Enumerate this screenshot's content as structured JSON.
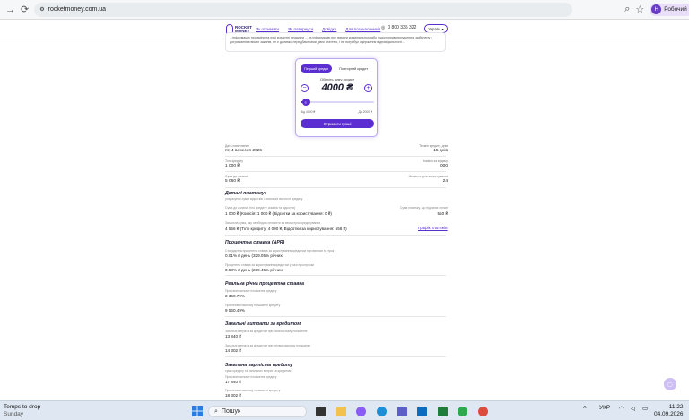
{
  "browser": {
    "url": "rocketmoney.com.ua",
    "profile_initial": "Н",
    "profile_name": "Робочий"
  },
  "site": {
    "logo_line1": "ROCKET",
    "logo_line2": "MONEY",
    "nav": [
      "Як отримати",
      "Як повернути",
      "Довідка",
      "Для позичальників"
    ],
    "phone": "0 800 335 322",
    "language": "Україн",
    "notice_text": "...інформацію про зміни та нові кредитні продукти ... та інформацію про вимоги кримінального або іншого правопорушення, здійснену з дотриманням вимог законів, не є даними, передбаченими діючі статтею, і не потребує одержання відповідальності..."
  },
  "calculator": {
    "tab_first": "Перший кредит",
    "tab_repeat": "Повторний кредит",
    "amount_label": "Оберіть суму позики",
    "amount": "4000 ₴",
    "slider_fraction": 0.07,
    "min_label": "Від 4000 ₴",
    "max_label": "До 2000 ₴",
    "cta": "Отримати гроші"
  },
  "summary": {
    "date_label": "Дата повернення",
    "date_value": "пт, 4 вересня 2026",
    "term_label": "Термін кредиту, днів",
    "term_value": "15 днів",
    "body_label": "Тіло кредиту",
    "body_value": "1 000 ₴",
    "fee_label": "Комісія за видачу",
    "fee_value": "000",
    "total_label": "Сума до сплати",
    "total_value": "5 060 ₴",
    "days_label": "Кількість днів користування",
    "days_value": "24"
  },
  "details": {
    "title": "Деталі платежу:",
    "subtitle": "розрахунок суми, відсотків і загальної вартості кредиту",
    "row1_label": "Сума до сплати (тіло кредиту, комісія та відсотки)",
    "row1_value": "1 000 ₴ (Комісія: 1 000 ₴ (Відсотки за користування: 0 ₴)",
    "row1_right_label": "Сума платежу, що підлягає сплаті",
    "row1_right_value": "550 ₴",
    "row2_label": "Загальна сума, яку необхідно сплатити за весь строк кредитування",
    "row2_value": "4 556 ₴ (Тіло кредиту: 4 000 ₴, Відсотки за користування: 556 ₴)",
    "schedule_link": "Графік платежів"
  },
  "apr": {
    "title": "Процентна ставка (APR)",
    "a_label": "Стандартна процентна ставка за користування кредитом при виплаті в строк",
    "a_value": "0.01% в день (329.05% річних)",
    "b_label": "Процентна ставка за користування кредитом у разі прострочки",
    "b_value": "0.53% в день (239.45% річних)"
  },
  "real_rate": {
    "title": "Реальна річна процентна ставка",
    "a_label": "При своєчасному погашенні кредиту",
    "a_value": "3 350.79%",
    "b_label": "При несвоєчасному погашенні кредиту",
    "b_value": "9 560.49%"
  },
  "total_costs": {
    "title": "Загальні витрати за кредитом",
    "a_label": "Загальні витрати за кредитом при своєчасному погашенні",
    "a_value": "13 840 ₴",
    "b_label": "Загальні витрати за кредитом при несвоєчасному погашенні",
    "b_value": "14 302 ₴"
  },
  "total_cost": {
    "title": "Загальна вартість кредиту",
    "subtitle": "сума кредиту та загальних витрат за кредитом",
    "a_label": "При своєчасному погашенні кредиту",
    "a_value": "17 840 ₴",
    "b_label": "При несвоєчасному погашенні кредиту",
    "b_value": "18 302 ₴"
  },
  "taskbar": {
    "weather_title": "Temps to drop",
    "weather_sub": "Sunday",
    "search_placeholder": "Пошук",
    "lang": "УКР",
    "time": "11:22",
    "date": "04.09.2026"
  }
}
